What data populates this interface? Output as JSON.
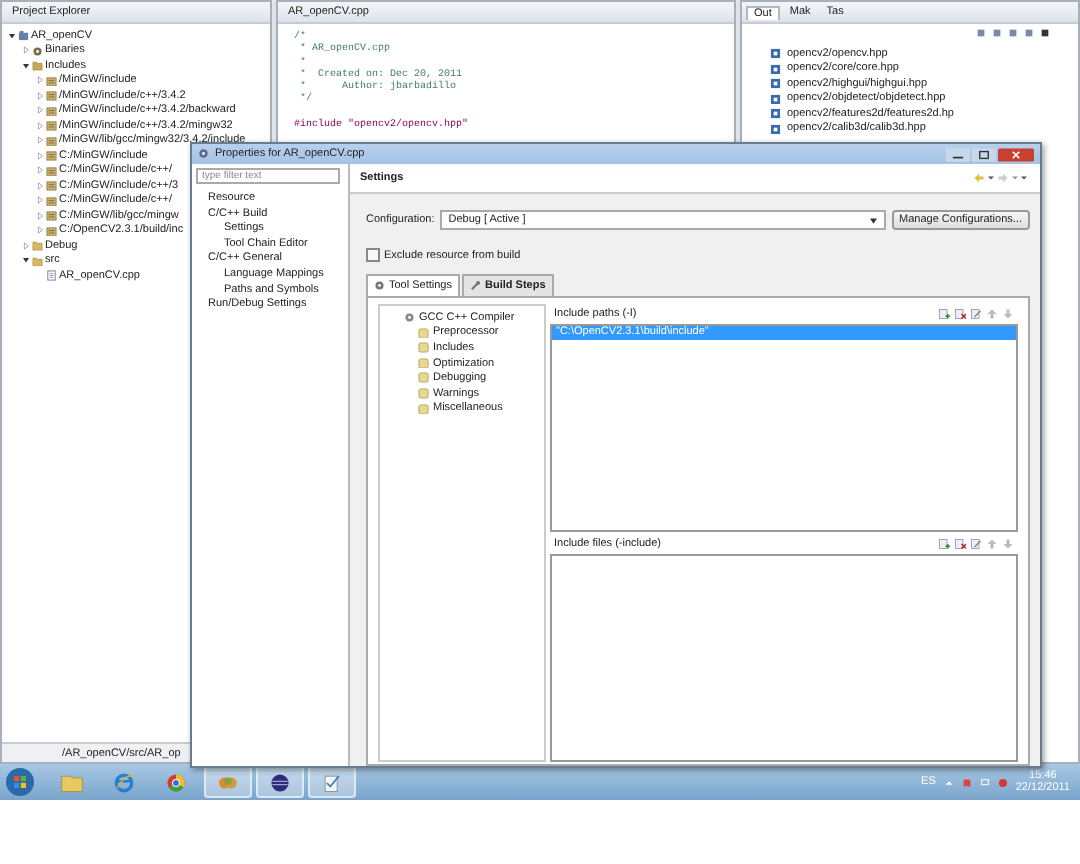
{
  "project_explorer": {
    "title": "Project Explorer",
    "tree": [
      {
        "label": "AR_openCV",
        "kind": "project",
        "expanded": true,
        "children": [
          {
            "label": "Binaries",
            "kind": "binaries",
            "expanded": false
          },
          {
            "label": "Includes",
            "kind": "includes",
            "expanded": true,
            "children": [
              {
                "label": "/MinGW/include",
                "kind": "include-path",
                "expanded": false
              },
              {
                "label": "/MinGW/include/c++/3.4.2",
                "kind": "include-path",
                "expanded": false
              },
              {
                "label": "/MinGW/include/c++/3.4.2/backward",
                "kind": "include-path",
                "expanded": false
              },
              {
                "label": "/MinGW/include/c++/3.4.2/mingw32",
                "kind": "include-path",
                "expanded": false
              },
              {
                "label": "/MinGW/lib/gcc/mingw32/3.4.2/include",
                "kind": "include-path",
                "expanded": false
              },
              {
                "label": "C:/MinGW/include",
                "kind": "include-path",
                "expanded": false
              },
              {
                "label": "C:/MinGW/include/c++/",
                "kind": "include-path",
                "expanded": false
              },
              {
                "label": "C:/MinGW/include/c++/3",
                "kind": "include-path",
                "expanded": false
              },
              {
                "label": "C:/MinGW/include/c++/",
                "kind": "include-path",
                "expanded": false
              },
              {
                "label": "C:/MinGW/lib/gcc/mingw",
                "kind": "include-path",
                "expanded": false
              },
              {
                "label": "C:/OpenCV2.3.1/build/inc",
                "kind": "include-path",
                "expanded": false
              }
            ]
          },
          {
            "label": "Debug",
            "kind": "folder",
            "expanded": false
          },
          {
            "label": "src",
            "kind": "source-folder",
            "expanded": true,
            "children": [
              {
                "label": "AR_openCV.cpp",
                "kind": "file"
              }
            ]
          }
        ]
      }
    ],
    "status": "/AR_openCV/src/AR_op"
  },
  "editor": {
    "tab": "AR_openCV.cpp",
    "lines": [
      {
        "text": "/*",
        "kind": "comment"
      },
      {
        "text": " * AR_openCV.cpp",
        "kind": "comment"
      },
      {
        "text": " *",
        "kind": "comment"
      },
      {
        "text": " *  Created on: Dec 20, 2011",
        "kind": "comment"
      },
      {
        "text": " *      Author: jbarbadillo",
        "kind": "comment"
      },
      {
        "text": " */",
        "kind": "comment"
      },
      {
        "kind": "blank"
      },
      {
        "text": "#include \"opencv2/opencv.hpp\"",
        "kind": "include"
      }
    ]
  },
  "outline": {
    "tabs": [
      {
        "label": "Out",
        "selected": true
      },
      {
        "label": "Mak",
        "selected": false
      },
      {
        "label": "Tas",
        "selected": false
      }
    ],
    "items": [
      "opencv2/opencv.hpp",
      "opencv2/core/core.hpp",
      "opencv2/highgui/highgui.hpp",
      "opencv2/objdetect/objdetect.hpp",
      "opencv2/features2d/features2d.hp",
      "opencv2/calib3d/calib3d.hpp"
    ]
  },
  "dialog": {
    "title": "Properties for AR_openCV.cpp",
    "filter": {
      "placeholder": "type filter text"
    },
    "nav": [
      {
        "label": "Resource"
      },
      {
        "label": "C/C++ Build",
        "children": [
          {
            "label": "Settings"
          },
          {
            "label": "Tool Chain Editor"
          }
        ]
      },
      {
        "label": "C/C++ General",
        "children": [
          {
            "label": "Language Mappings"
          },
          {
            "label": "Paths and Symbols"
          }
        ]
      },
      {
        "label": "Run/Debug Settings"
      }
    ],
    "page_title": "Settings",
    "configuration_label": "Configuration:",
    "configuration_value": "Debug  [ Active ]",
    "manage_button": "Manage Configurations...",
    "exclude": {
      "label": "Exclude resource from build",
      "checked": false
    },
    "tabs": [
      {
        "label": "Tool Settings",
        "selected": true
      },
      {
        "label": "Build Steps",
        "selected": false
      }
    ],
    "tool_tree": [
      {
        "label": "GCC C++ Compiler",
        "children": [
          {
            "label": "Preprocessor"
          },
          {
            "label": "Includes"
          },
          {
            "label": "Optimization"
          },
          {
            "label": "Debugging"
          },
          {
            "label": "Warnings"
          },
          {
            "label": "Miscellaneous"
          }
        ]
      }
    ],
    "include_paths": {
      "title": "Include paths (-I)",
      "items": [
        {
          "label": "\"C:\\OpenCV2.3.1\\build\\include\"",
          "selected": true
        }
      ]
    },
    "include_files": {
      "title": "Include files (-include)"
    }
  },
  "taskbar": {
    "language": "ES",
    "time": "15:46",
    "date": "22/12/2011"
  }
}
